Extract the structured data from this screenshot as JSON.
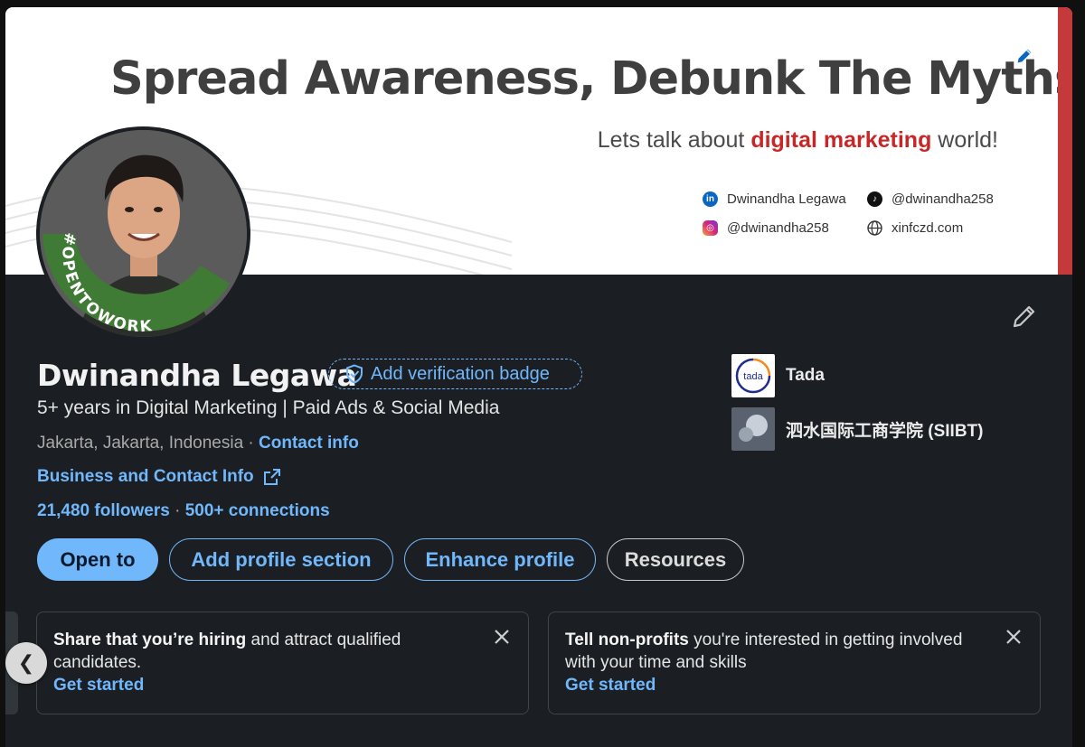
{
  "banner": {
    "headline": "Spread Awareness, Debunk The Myths",
    "tagline_pre": "Lets talk about ",
    "tagline_accent": "digital marketing",
    "tagline_post": " world!",
    "socials": [
      {
        "icon": "linkedin-icon",
        "text": "Dwinandha Legawa"
      },
      {
        "icon": "tiktok-icon",
        "text": "@dwinandha258"
      },
      {
        "icon": "instagram-icon",
        "text": "@dwinandha258"
      },
      {
        "icon": "globe-icon",
        "text": "xinfczd.com"
      }
    ],
    "accent_color": "#c62828"
  },
  "avatar": {
    "frame_text": "#OPENTOWORK",
    "frame_color": "#3f7b34"
  },
  "profile": {
    "name": "Dwinandha Legawa",
    "verify_label": "Add verification badge",
    "headline": "5+ years in Digital Marketing | Paid Ads & Social Media",
    "location": "Jakarta, Jakarta, Indonesia",
    "location_sep": " · ",
    "contact_info": "Contact info",
    "business_info": "Business and Contact Info",
    "followers": "21,480 followers",
    "stats_sep": "  · ",
    "connections": "500+ connections"
  },
  "orgs": [
    {
      "name": "Tada",
      "logo_text": "tada"
    },
    {
      "name": "泗水国际工商学院 (SIIBT)"
    }
  ],
  "actions": {
    "open_to": "Open to",
    "add_section": "Add profile section",
    "enhance": "Enhance profile",
    "resources": "Resources"
  },
  "promos": [
    {
      "bold": "Share that you’re hiring",
      "rest": " and attract qualified candidates.",
      "cta": "Get started"
    },
    {
      "bold": "Tell non-profits",
      "rest": " you're interested in getting involved with your time and skills",
      "cta": "Get started"
    }
  ],
  "carousel": {
    "prev_glyph": "❮"
  },
  "colors": {
    "link": "#71b7fb",
    "card_bg": "#1b1f23"
  }
}
